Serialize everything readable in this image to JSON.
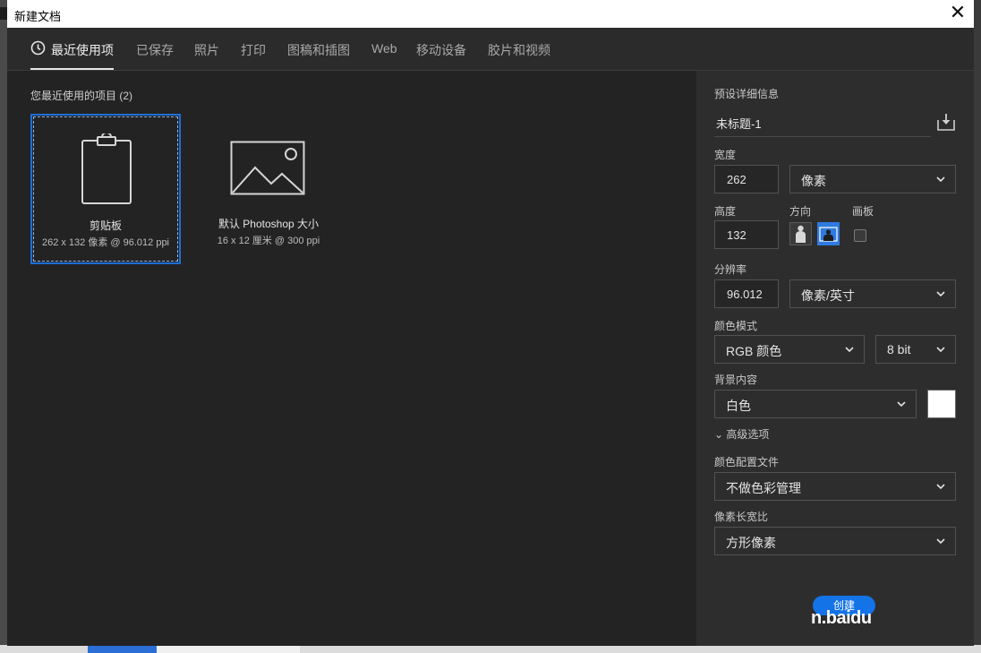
{
  "window": {
    "title": "新建文档",
    "close_glyph": "✕"
  },
  "tabs": [
    {
      "label": "最近使用项",
      "active": true
    },
    {
      "label": "已保存"
    },
    {
      "label": "照片"
    },
    {
      "label": "打印"
    },
    {
      "label": "图稿和插图"
    },
    {
      "label": "Web"
    },
    {
      "label": "移动设备"
    },
    {
      "label": "胶片和视频"
    }
  ],
  "recent": {
    "heading": "您最近使用的项目 (2)",
    "items": [
      {
        "name": "剪贴板",
        "meta": "262 x 132 像素 @ 96.012 ppi",
        "icon": "clipboard-icon",
        "selected": true
      },
      {
        "name": "默认 Photoshop 大小",
        "meta": "16 x 12 厘米 @ 300 ppi",
        "icon": "image-icon"
      }
    ]
  },
  "preset": {
    "heading": "预设详细信息",
    "doc_name": "未标题-1",
    "width_label": "宽度",
    "width_value": "262",
    "width_unit": "像素",
    "height_label": "高度",
    "height_value": "132",
    "orientation_label": "方向",
    "artboard_label": "画板",
    "resolution_label": "分辨率",
    "resolution_value": "96.012",
    "resolution_unit": "像素/英寸",
    "color_mode_label": "颜色模式",
    "color_mode": "RGB 颜色",
    "bit_depth": "8 bit",
    "background_label": "背景内容",
    "background": "白色",
    "background_swatch": "#ffffff",
    "advanced_label": "高级选项",
    "advanced_glyph": "⌄",
    "color_profile_label": "颜色配置文件",
    "color_profile": "不做色彩管理",
    "pixel_aspect_label": "像素长宽比",
    "pixel_aspect": "方形像素",
    "create_label": "创建"
  },
  "watermark": "n.baidu",
  "colors": {
    "accent": "#1473e6",
    "selection": "#1c6fd6",
    "dialog_bg": "#232323",
    "panel_bg": "#2d2d2d"
  }
}
